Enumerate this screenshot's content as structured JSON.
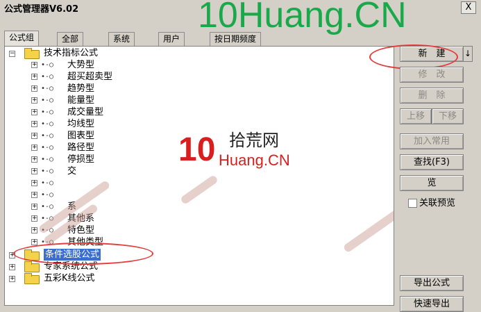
{
  "window": {
    "title": "公式管理器V6.02",
    "close_label": "X"
  },
  "watermark": {
    "top_text": "10Huang.CN",
    "logo_number": "10",
    "logo_cn": "拾荒网",
    "logo_en": "Huang.CN"
  },
  "tabs": [
    {
      "label": "公式组",
      "active": true
    },
    {
      "label": "全部",
      "active": false
    },
    {
      "label": "系统",
      "active": false
    },
    {
      "label": "用户",
      "active": false
    },
    {
      "label": "按日期频度",
      "active": false
    }
  ],
  "tree": {
    "root1": {
      "label": "技术指标公式",
      "expander": "−"
    },
    "children": [
      "大势型",
      "超买超卖型",
      "趋势型",
      "能量型",
      "成交量型",
      "均线型",
      "图表型",
      "路径型",
      "停损型",
      "交",
      "",
      "",
      "系",
      "其他系",
      "特色型",
      "其他类型"
    ],
    "root2": {
      "label": "条件选股公式",
      "expander": "+"
    },
    "root3": {
      "label": "专家系统公式",
      "expander": "+"
    },
    "root4": {
      "label": "五彩K线公式",
      "expander": "+"
    },
    "child_expander": "+",
    "key_glyph": "•-○"
  },
  "buttons": {
    "new": "新　建",
    "new_arrow": "↓",
    "modify": "修　改",
    "delete": "删　除",
    "move_up": "上移",
    "move_down": "下移",
    "add_common": "加入常用",
    "find": "查找(F3)",
    "preview": "览",
    "link_preview": "关联预览",
    "export": "导出公式",
    "quick_export": "快速导出"
  },
  "colors": {
    "watermark_green": "#19a84a",
    "annotation_red": "#e53b3b",
    "selection_blue": "#3a6fd1"
  }
}
